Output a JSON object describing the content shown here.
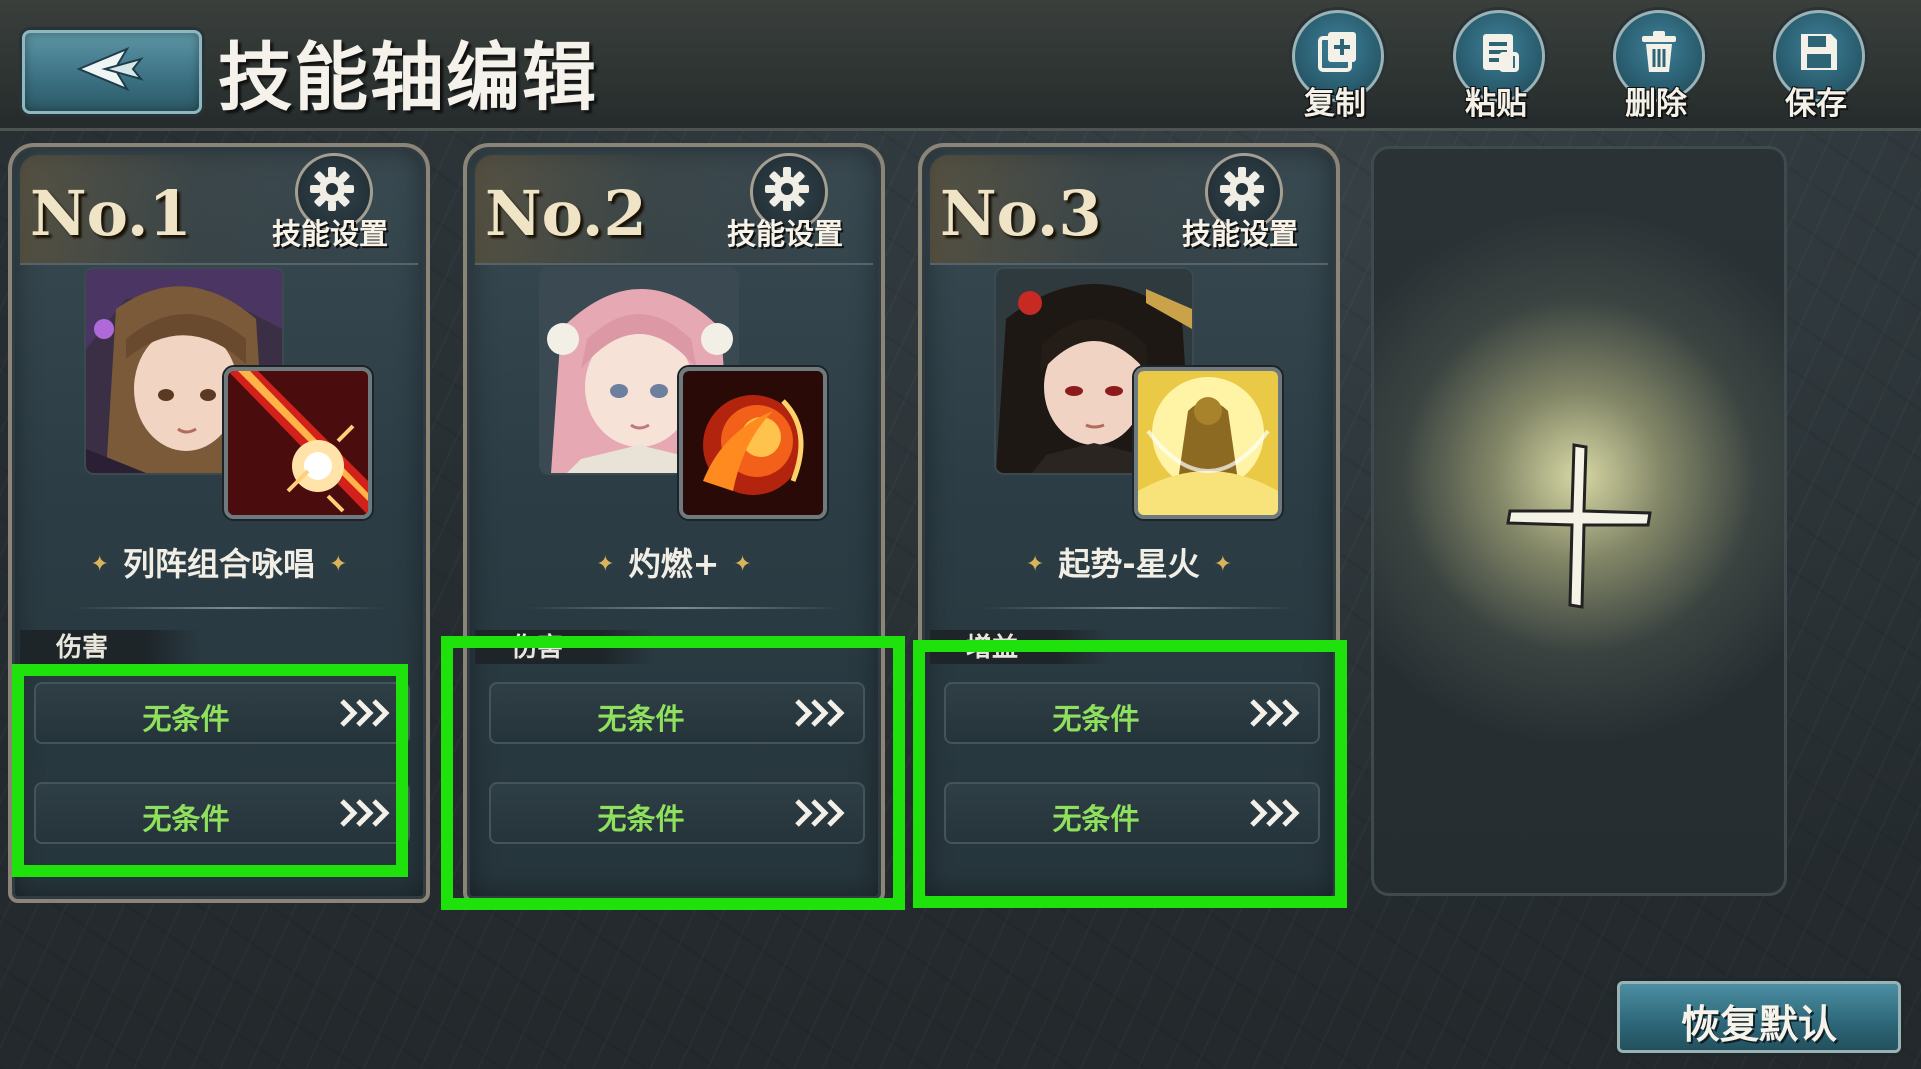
{
  "header": {
    "title": "技能轴编辑",
    "back_icon": "back-arrow-icon",
    "tools": [
      {
        "label": "复制",
        "icon": "copy-icon"
      },
      {
        "label": "粘贴",
        "icon": "paste-icon"
      },
      {
        "label": "删除",
        "icon": "trash-icon"
      },
      {
        "label": "保存",
        "icon": "save-icon"
      }
    ]
  },
  "cards": [
    {
      "number": "No.1",
      "settings_label": "技能设置",
      "skill_name": "列阵组合咏唱",
      "tag": "伤害",
      "conditions": [
        "无条件",
        "无条件"
      ]
    },
    {
      "number": "No.2",
      "settings_label": "技能设置",
      "skill_name": "灼燃+",
      "tag": "伤害",
      "conditions": [
        "无条件",
        "无条件"
      ]
    },
    {
      "number": "No.3",
      "settings_label": "技能设置",
      "skill_name": "起势-星火",
      "tag": "增益",
      "conditions": [
        "无条件",
        "无条件"
      ]
    }
  ],
  "empty_slot_icon": "plus-icon",
  "footer": {
    "reset_label": "恢复默认"
  },
  "colors": {
    "highlight": "#1fe20c",
    "condition_text": "#8ee05d",
    "button_blue": "#3d7385"
  }
}
